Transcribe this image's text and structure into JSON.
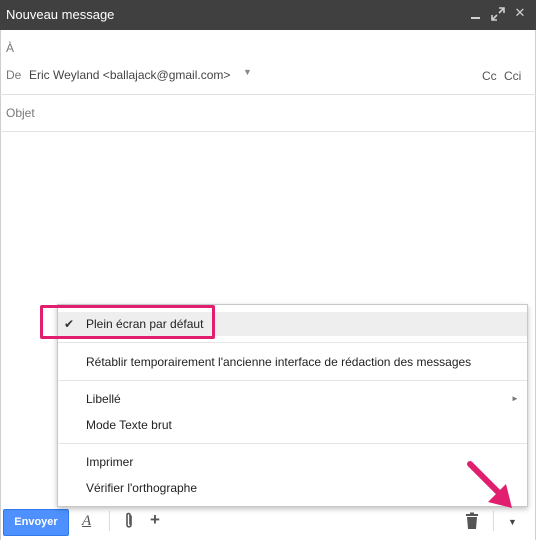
{
  "window": {
    "title": "Nouveau message",
    "controls": {
      "minimize": "minimize-icon",
      "maximize": "expand-icon",
      "close": "✕"
    }
  },
  "header": {
    "to_label": "À",
    "from_label": "De",
    "from_value": "Eric Weyland <ballajack@gmail.com>",
    "cc": "Cc",
    "cci": "Cci",
    "subject_placeholder": "Objet"
  },
  "toolbar": {
    "send_label": "Envoyer",
    "format_icon": "A"
  },
  "menu": {
    "items": [
      {
        "label": "Plein écran par défaut",
        "checked": true
      },
      {
        "label": "Rétablir temporairement l'ancienne interface de rédaction des messages"
      },
      {
        "label": "Libellé",
        "has_submenu": true
      },
      {
        "label": "Mode Texte brut"
      },
      {
        "label": "Imprimer"
      },
      {
        "label": "Vérifier l'orthographe"
      }
    ]
  },
  "colors": {
    "titlebar": "#404040",
    "send_button": "#4d90fe",
    "highlight": "#e0206e"
  }
}
